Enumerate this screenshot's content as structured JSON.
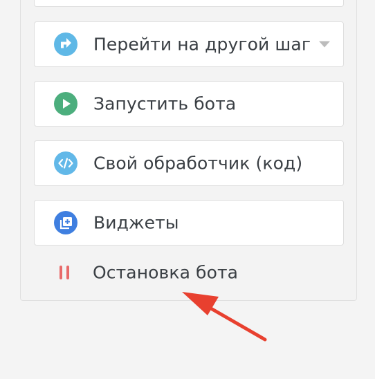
{
  "colors": {
    "goto_icon": "#5fb8e6",
    "run_icon": "#4cae7d",
    "code_icon": "#62b8e8",
    "widgets_icon": "#3f7fe0",
    "stop_icon": "#e86a6a",
    "arrow": "#e8402f"
  },
  "actions": {
    "goto_step": {
      "label": "Перейти на другой шаг",
      "icon": "goto-icon",
      "has_dropdown": true
    },
    "run_bot": {
      "label": "Запустить бота",
      "icon": "play-icon"
    },
    "custom_handler": {
      "label": "Свой обработчик (код)",
      "icon": "code-icon"
    },
    "widgets": {
      "label": "Виджеты",
      "icon": "widget-add-icon"
    },
    "stop_bot": {
      "label": "Остановка бота",
      "icon": "pause-icon"
    }
  }
}
